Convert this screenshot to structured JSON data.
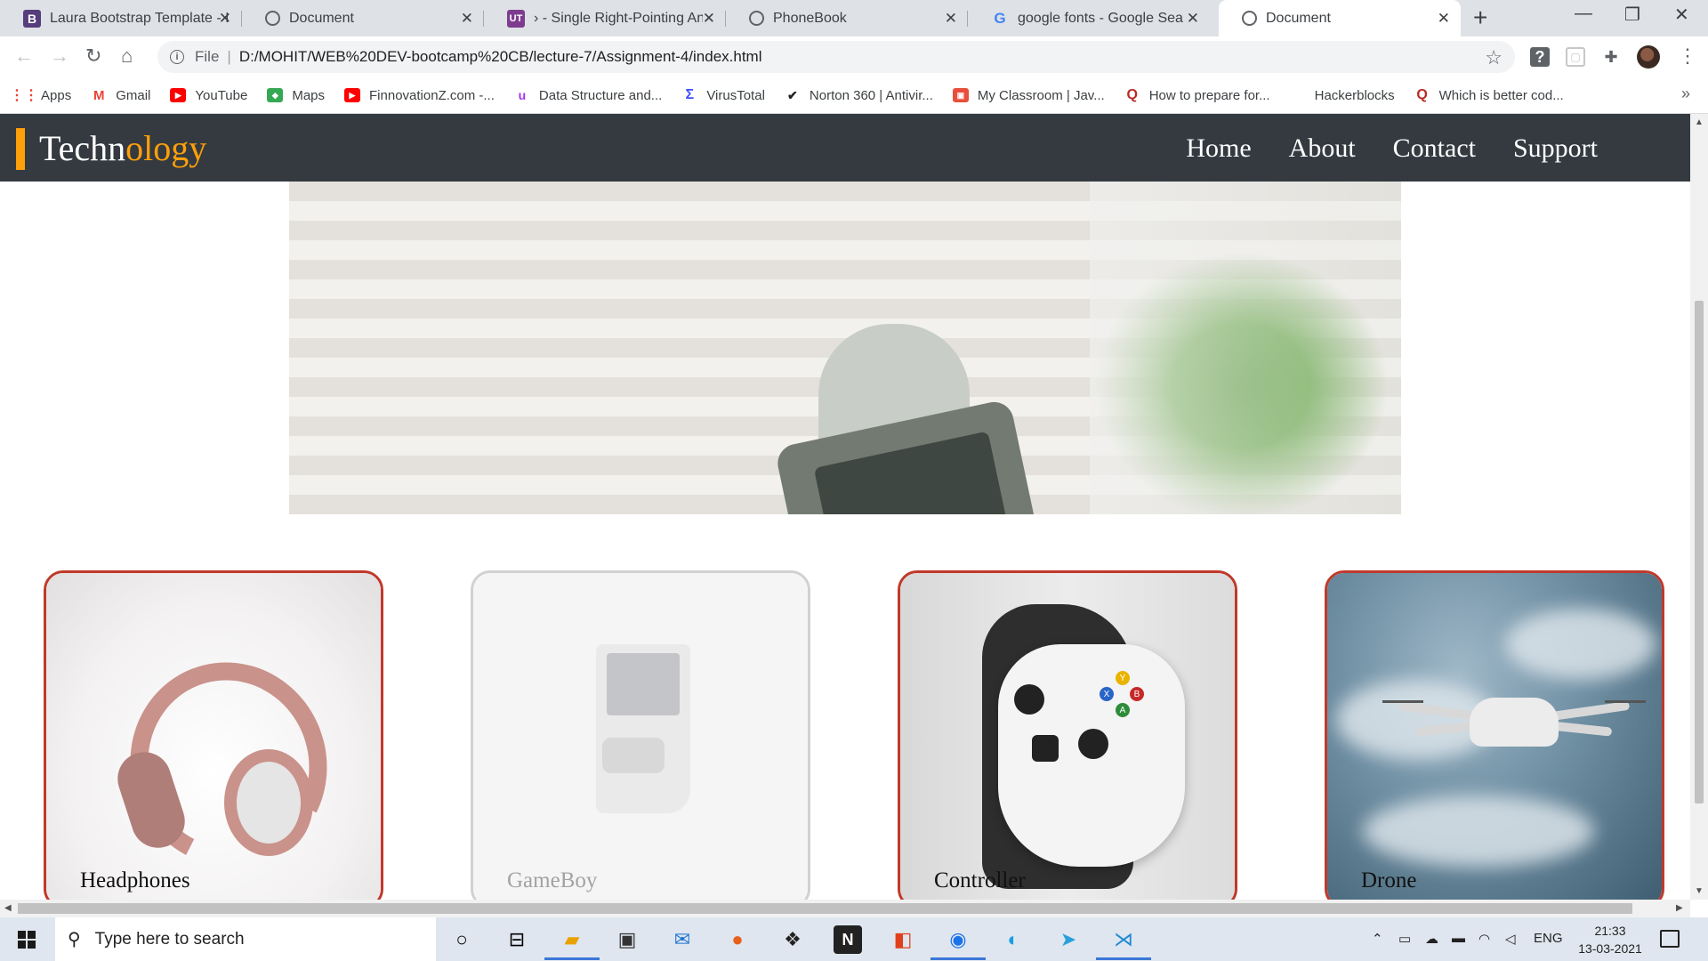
{
  "browser": {
    "tabs": [
      {
        "title": "Laura Bootstrap Template - In",
        "favicon": "B",
        "favicon_color": "#563d7c",
        "active": false
      },
      {
        "title": "Document",
        "favicon": "globe",
        "favicon_color": "#5f6368",
        "active": false
      },
      {
        "title": "› - Single Right-Pointing Ang",
        "favicon": "UT",
        "favicon_color": "#7e3c8f",
        "active": false
      },
      {
        "title": "PhoneBook",
        "favicon": "globe",
        "favicon_color": "#5f6368",
        "active": false
      },
      {
        "title": "google fonts - Google Search",
        "favicon": "G",
        "favicon_color": "#4285f4",
        "active": false
      },
      {
        "title": "Document",
        "favicon": "globe",
        "favicon_color": "#5f6368",
        "active": true
      }
    ],
    "url_scheme_label": "File",
    "url": "D:/MOHIT/WEB%20DEV-bootcamp%20CB/lecture-7/Assignment-4/index.html",
    "bookmarks": [
      {
        "label": "Apps",
        "icon": "apps-grid-icon",
        "color": "#ea4335"
      },
      {
        "label": "Gmail",
        "icon": "gmail-icon",
        "color": "#ea4335"
      },
      {
        "label": "YouTube",
        "icon": "youtube-icon",
        "color": "#ff0000"
      },
      {
        "label": "Maps",
        "icon": "maps-icon",
        "color": "#34a853"
      },
      {
        "label": "FinnovationZ.com -...",
        "icon": "youtube-icon",
        "color": "#ff0000"
      },
      {
        "label": "Data Structure and...",
        "icon": "udemy-icon",
        "color": "#a435f0"
      },
      {
        "label": "VirusTotal",
        "icon": "virustotal-icon",
        "color": "#394eff"
      },
      {
        "label": "Norton 360 | Antivir...",
        "icon": "norton-icon",
        "color": "#ffc400"
      },
      {
        "label": "My Classroom | Jav...",
        "icon": "classroom-icon",
        "color": "#e94e3c"
      },
      {
        "label": "How to prepare for...",
        "icon": "quora-icon",
        "color": "#b92b27"
      },
      {
        "label": "Hackerblocks",
        "icon": "",
        "color": ""
      },
      {
        "label": "Which is better cod...",
        "icon": "quora-icon",
        "color": "#b92b27"
      }
    ]
  },
  "site": {
    "brand_part1": "Techn",
    "brand_part2": "ology",
    "brand_accent_color": "#ff9f0a",
    "nav_bg": "#343a40",
    "nav": [
      "Home",
      "About",
      "Contact",
      "Support"
    ],
    "cards": [
      {
        "label": "Headphones",
        "dim": false
      },
      {
        "label": "GameBoy",
        "dim": true
      },
      {
        "label": "Controller",
        "dim": false
      },
      {
        "label": "Drone",
        "dim": false
      }
    ]
  },
  "taskbar": {
    "search_placeholder": "Type here to search",
    "language": "ENG",
    "time": "21:33",
    "date": "13-03-2021"
  }
}
